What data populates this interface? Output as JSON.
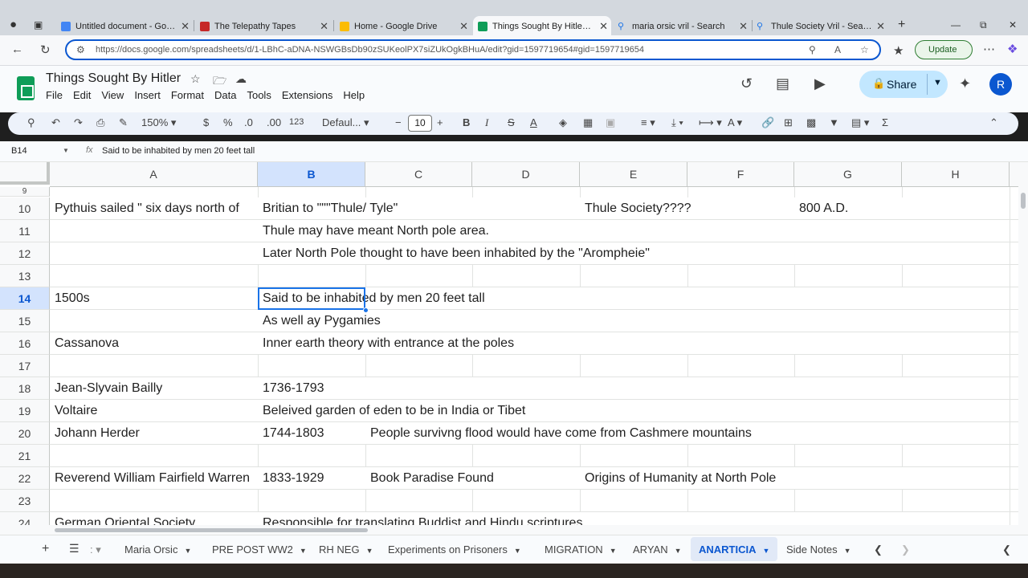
{
  "browser": {
    "tabs": [
      {
        "label": "Untitled document - Google",
        "icon": "docs-icon",
        "color": "#4285f4"
      },
      {
        "label": "The Telepathy Tapes",
        "icon": "telepathy-icon",
        "color": "#c62828"
      },
      {
        "label": "Home - Google Drive",
        "icon": "drive-icon",
        "color": "#fbbc04"
      },
      {
        "label": "Things Sought By Hitler - Go",
        "icon": "sheets-icon",
        "color": "#0f9d58"
      },
      {
        "label": "maria orsic vril - Search",
        "icon": "search-icon",
        "color": "#1a73e8"
      },
      {
        "label": "Thule Society Vril - Search Im",
        "icon": "search-icon",
        "color": "#1a73e8"
      }
    ],
    "url": "https://docs.google.com/spreadsheets/d/1-LBhC-aDNA-NSWGBsDb90zSUKeolPX7siZUkOgkBHuA/edit?gid=1597719654#gid=1597719654",
    "update_label": "Update"
  },
  "doc": {
    "title": "Things Sought By Hitler",
    "menu": [
      "File",
      "Edit",
      "View",
      "Insert",
      "Format",
      "Data",
      "Tools",
      "Extensions",
      "Help"
    ],
    "share_label": "Share",
    "avatar_initial": "R"
  },
  "toolbar": {
    "zoom": "150%",
    "currency": "$",
    "percent": "%",
    "dec_decrease": ".0",
    "dec_increase": ".00",
    "number_format": "123",
    "font": "Defaul...",
    "font_size": "10"
  },
  "formula": {
    "cell_ref": "B14",
    "fx": "fx",
    "content": "Said to be inhabited by men 20 feet tall"
  },
  "grid": {
    "columns": [
      "A",
      "B",
      "C",
      "D",
      "E",
      "F",
      "G",
      "H"
    ],
    "selected_column": "B",
    "selected_row": "14",
    "rows": [
      {
        "num": "10",
        "A": "Pythuis sailed \" six days north of",
        "B": "Britian to \"\"\"Thule/ Tyle\"",
        "C": "",
        "D": "",
        "E": "Thule Society????",
        "G": "800 A.D."
      },
      {
        "num": "11",
        "A": "",
        "B": "Thule may have meant North pole area.",
        "C": "",
        "E": "",
        "G": ""
      },
      {
        "num": "12",
        "A": "",
        "B": "Later North Pole thought to have been inhabited by the \"Arompheie\"",
        "C": "",
        "E": "",
        "G": ""
      },
      {
        "num": "13",
        "A": "",
        "B": "",
        "C": "",
        "E": "",
        "G": ""
      },
      {
        "num": "14",
        "A": "1500s",
        "B": "Said to be inhabited by men 20 feet tall",
        "C": "",
        "E": "",
        "G": ""
      },
      {
        "num": "15",
        "A": "",
        "B": "As well ay Pygamies",
        "C": "",
        "E": "",
        "G": ""
      },
      {
        "num": "16",
        "A": "Cassanova",
        "B": "Inner earth theory with entrance at the poles",
        "C": "",
        "E": "",
        "G": ""
      },
      {
        "num": "17",
        "A": "",
        "B": "",
        "C": "",
        "E": "",
        "G": ""
      },
      {
        "num": "18",
        "A": "Jean-Slyvain Bailly",
        "B": "1736-1793",
        "C": "",
        "E": "",
        "G": ""
      },
      {
        "num": "19",
        "A": "Voltaire",
        "B": "Beleived garden of eden to be in India or Tibet",
        "C": "",
        "E": "",
        "G": ""
      },
      {
        "num": "20",
        "A": "Johann Herder",
        "B": "1744-1803",
        "C": "People survivng flood would have come from Cashmere mountains",
        "E": "",
        "G": ""
      },
      {
        "num": "21",
        "A": "",
        "B": "",
        "C": "",
        "E": "",
        "G": ""
      },
      {
        "num": "22",
        "A": "Reverend William Fairfield Warren",
        "B": "1833-1929",
        "C": "Book Paradise Found",
        "E": "Origins of Humanity at North Pole",
        "G": ""
      },
      {
        "num": "23",
        "A": "",
        "B": "",
        "C": "",
        "E": "",
        "G": ""
      },
      {
        "num": "24",
        "A": "German Oriental Society",
        "B": "Responsible for translating Buddist and Hindu scriptures",
        "C": "",
        "E": "",
        "G": ""
      }
    ]
  },
  "sheets": {
    "tabs": [
      "Maria Orsic",
      "PRE POST WW2",
      "RH NEG",
      "Experiments on Prisoners",
      "MIGRATION",
      "ARYAN",
      "ANARTICIA",
      "Side Notes"
    ],
    "active": "ANARTICIA"
  }
}
